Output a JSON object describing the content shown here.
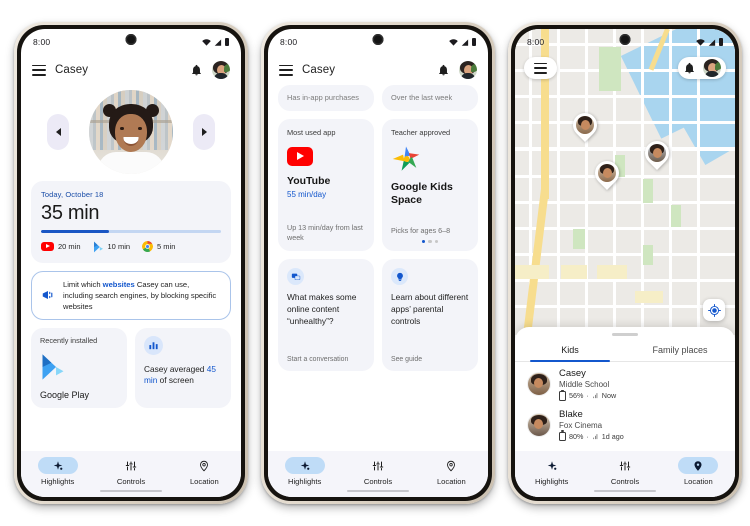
{
  "meta": {
    "product": "Google Family Link",
    "screens": [
      "Highlights",
      "Highlights scrolled",
      "Location"
    ]
  },
  "colors": {
    "accent_blue": "#1357cd",
    "progress_fill": "#1a56c4",
    "progress_track": "#c3d6f2",
    "card_bg": "#f3f4f9",
    "nav_pill": "#bfdcf7",
    "youtube_red": "#ff0000",
    "map_water": "#a9d5ef",
    "map_highway": "#f7dd8e",
    "map_park": "#cfe6c0",
    "phone_frame": "#e2d9cc"
  },
  "status_bar": {
    "time": "8:00",
    "icons": [
      "wifi-icon",
      "signal-icon",
      "battery-icon"
    ]
  },
  "app_bar": {
    "menu_icon": "hamburger-menu-icon",
    "title": "Casey",
    "bell_icon": "notification-bell-icon",
    "avatar": "parent-avatar"
  },
  "phone1": {
    "hero": {
      "prev_label": "previous child",
      "next_label": "next child",
      "photo_alt": "Casey profile photo"
    },
    "usage_card": {
      "date": "Today, October 18",
      "total": "35 min",
      "progress_percent": 38,
      "apps": [
        {
          "icon": "youtube-icon",
          "time": "20 min"
        },
        {
          "icon": "google-play-icon",
          "time": "10 min"
        },
        {
          "icon": "chrome-icon",
          "time": "5 min"
        }
      ]
    },
    "tip_card": {
      "icon": "website-filter-icon",
      "text_part1": "Limit which ",
      "text_link": "websites",
      "text_part2": " Casey can use, including search engines, by blocking specific websites"
    },
    "recently_installed": {
      "label": "Recently installed",
      "icon": "google-play-icon",
      "app_name": "Google Play"
    },
    "average_card": {
      "icon": "bar-chart-icon",
      "text_prefix": "Casey averaged ",
      "text_highlight": "45 min",
      "text_suffix": " of screen"
    }
  },
  "phone2": {
    "peek_left": "Has in-app purchases",
    "peek_right": "Over the last week",
    "most_used": {
      "label": "Most used app",
      "icon": "youtube-icon",
      "app_name": "YouTube",
      "usage": "55 min/day",
      "footer": "Up 13 min/day from last week"
    },
    "teacher_approved": {
      "label": "Teacher approved",
      "icon": "google-kids-space-icon",
      "app_name": "Google Kids Space",
      "footer": "Picks for ages 6–8",
      "dots": 3,
      "active_dot": 0
    },
    "question_card": {
      "icon": "chat-bubble-icon",
      "text": "What makes some online content “unhealthy”?",
      "footer": "Start a conversation"
    },
    "guide_card": {
      "icon": "lightbulb-icon",
      "text": "Learn about different apps’ parental controls",
      "footer": "See guide"
    }
  },
  "phone3": {
    "map": {
      "menu_icon": "hamburger-menu-icon",
      "bell_icon": "notification-bell-icon",
      "avatar": "parent-avatar",
      "recenter_icon": "my-location-icon",
      "pins": [
        "kid-pin-1",
        "kid-pin-2",
        "kid-pin-3"
      ]
    },
    "sheet": {
      "tabs": [
        {
          "label": "Kids",
          "active": true
        },
        {
          "label": "Family places",
          "active": false
        }
      ],
      "kids": [
        {
          "name": "Casey",
          "place": "Middle School",
          "battery": "56%",
          "separator": "·",
          "signal_icon": "cell-signal-icon",
          "updated": "Now"
        },
        {
          "name": "Blake",
          "place": "Fox Cinema",
          "battery": "80%",
          "separator": "·",
          "signal_icon": "cell-signal-icon",
          "updated": "1d ago"
        }
      ]
    }
  },
  "bottom_nav": {
    "items": [
      {
        "icon": "sparkle-icon",
        "label": "Highlights"
      },
      {
        "icon": "sliders-icon",
        "label": "Controls"
      },
      {
        "icon": "location-pin-icon",
        "label": "Location"
      }
    ],
    "active_phone1": 0,
    "active_phone2": 0,
    "active_phone3": 2
  }
}
